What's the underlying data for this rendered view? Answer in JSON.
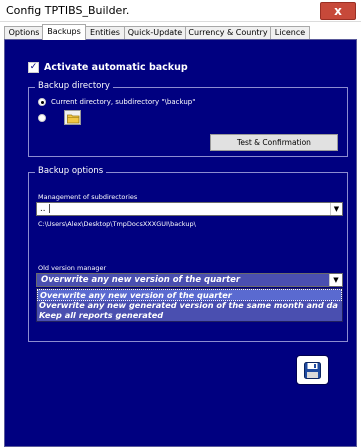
{
  "window": {
    "title": "Config TPTIBS_Builder.",
    "close_symbol": "x"
  },
  "tabs": [
    {
      "label": "Options",
      "active": false
    },
    {
      "label": "Backups",
      "active": true
    },
    {
      "label": "Entities",
      "active": false
    },
    {
      "label": "Quick-Update",
      "active": false
    },
    {
      "label": "Currency & Country",
      "active": false
    },
    {
      "label": "Licence",
      "active": false
    }
  ],
  "auto_backup": {
    "label": "Activate automatic backup",
    "checked": true,
    "check_symbol": "✓"
  },
  "backup_directory": {
    "title": "Backup directory",
    "option_current": "Current directory, subdirectory \"\\backup\"",
    "option_custom_selected": false,
    "folder_icon": "folder-icon",
    "test_button": "Test & Confirmation"
  },
  "backup_options": {
    "title": "Backup options",
    "subdirs_label": "Management of subdirectories",
    "subdirs_value": ".. |",
    "path": "C:\\Users\\Alex\\Desktop\\TmpDocsXXXGUI\\backup\\",
    "old_version_label": "Old version manager",
    "old_version_value": "Overwrite any new version of the quarter",
    "old_version_options": [
      "Overwrite any new version of the quarter",
      "Overwrite any new generated version of the same month and da",
      "Keep all reports generated"
    ],
    "dropdown_arrow": "▼"
  },
  "save_icon": "floppy-disk-icon",
  "colors": {
    "panel": "#000080",
    "dropdown": "#4a4fb0",
    "close": "#c7493a"
  }
}
